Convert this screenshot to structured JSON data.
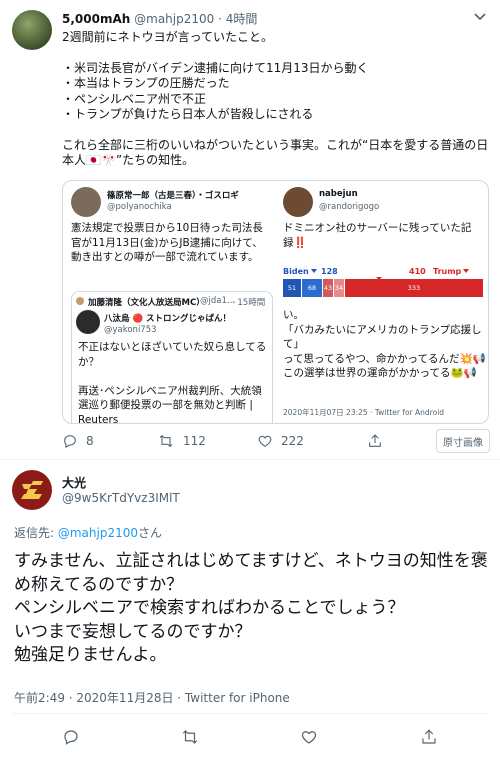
{
  "tweet1": {
    "author_name": "5,000mAh",
    "author_handle": "@mahjp2100",
    "time_sep": "·",
    "time": "4時間",
    "body": "2週間前にネトウヨが言っていたこと。\n\n・米司法長官がバイデン逮捕に向けて11月13日から動く\n・本当はトランプの圧勝だった\n・ペンシルベニア州で不正\n・トランプが負けたら日本人が皆殺しにされる\n\nこれら全部に三桁のいいねがついたという事実。これが“日本を愛する普通の日本人🇯🇵🎌”たちの知性。",
    "quote": {
      "left_author_name": "篠原常一郎（古是三春）・ゴスロギ",
      "left_author_handle": "@polyanochika",
      "left_text": "憲法規定で投票日から10日待った司法長官が11月13日(金)からJB逮捕に向けて、動き出すとの噂が一部で流れています。",
      "left_retweeter": "加藤清隆（文化人放送局MC）",
      "left_retweeter_handle": "@jda1…",
      "left_retweeter_time": "· 15時間",
      "inner_author_name": "八汰烏 🔴 ストロングじゃぱん！",
      "inner_author_handle": "@yakoni753",
      "inner_text": "不正はないとほざいていた奴ら息してるか？\n\n再送･ペンシルベニア州裁判所、大統領選巡り郵便投票の一部を無効と判断 | Reuters",
      "right_author_name": "nabejun",
      "right_author_handle": "@randorigogo",
      "right_text_top": "ドミニオン社のサーバーに残っていた記録‼️",
      "right_text_bottom": "い。\n「バカみたいにアメリカのトランプ応援して」\nって思ってるやつ、命かかってるんだ💥📢\nこの選挙は世界の運命がかかってる🐸📢",
      "right_footer": "2020年11月07日 23:25 · Twitter for Android",
      "chart": {
        "biden_label": "Biden",
        "biden_total": "128",
        "trump_label": "Trump",
        "trump_total": "410",
        "biden_segments": [
          "51",
          "68",
          "43",
          "34"
        ],
        "trump_segments": [
          "333"
        ],
        "biden_color": "#2156b4",
        "trump_color": "#d62828"
      }
    },
    "actions": {
      "reply_count": "8",
      "retweet_count": "112",
      "like_count": "222"
    },
    "original_image_label": "原寸画像"
  },
  "tweet2": {
    "author_name": "大光",
    "author_handle": "@9w5KrTdYvz3IMlT",
    "reply_prefix": "返信先: ",
    "reply_to": "@mahjp2100",
    "reply_suffix": "さん",
    "body": "すみません、立証されはじめてますけど、ネトウヨの知性を褒め称えてるのですか？\nペンシルベニアで検索すればわかることでしょう？\nいつまで妄想してるのですか？\n勉強足りませんよ。",
    "meta_time": "午前2:49 · 2020年11月28日 · ",
    "meta_client": "Twitter for iPhone"
  },
  "icons": {
    "reply": "reply-icon",
    "retweet": "retweet-icon",
    "like": "like-icon",
    "share": "share-icon",
    "caret": "chevron-down-icon"
  },
  "colors": {
    "accent": "#1d9bf0",
    "muted": "#536471",
    "text": "#0f1419",
    "avatar2_bg": "#8a1b17"
  }
}
